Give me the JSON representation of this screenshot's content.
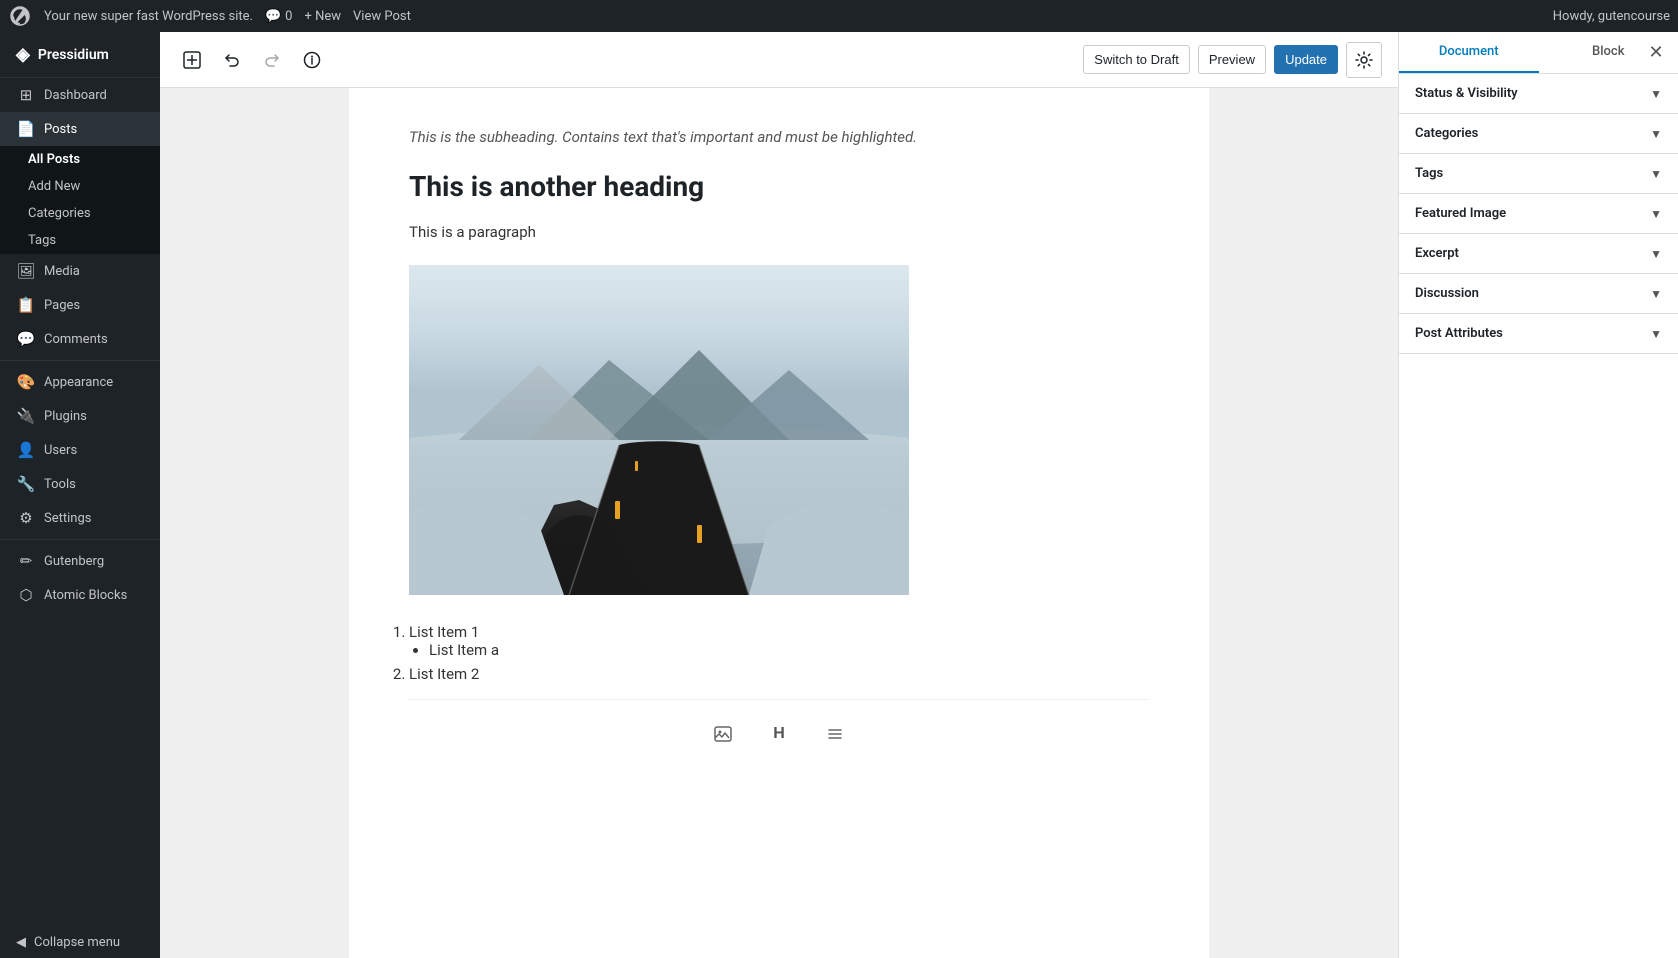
{
  "adminBar": {
    "wpIcon": "⊞",
    "siteName": "Your new super fast WordPress site.",
    "commentIcon": "💬",
    "commentCount": "0",
    "newLabel": "+ New",
    "viewPost": "View Post",
    "howdy": "Howdy, gutencourse"
  },
  "sidebar": {
    "brand": "Pressidium",
    "items": [
      {
        "id": "dashboard",
        "label": "Dashboard",
        "icon": "⊞"
      },
      {
        "id": "posts",
        "label": "Posts",
        "icon": "📄",
        "active": true,
        "children": [
          {
            "id": "all-posts",
            "label": "All Posts",
            "activeChild": true
          },
          {
            "id": "add-new",
            "label": "Add New"
          },
          {
            "id": "categories",
            "label": "Categories"
          },
          {
            "id": "tags",
            "label": "Tags"
          }
        ]
      },
      {
        "id": "media",
        "label": "Media",
        "icon": "🖼"
      },
      {
        "id": "pages",
        "label": "Pages",
        "icon": "📋"
      },
      {
        "id": "comments",
        "label": "Comments",
        "icon": "💬"
      },
      {
        "id": "appearance",
        "label": "Appearance",
        "icon": "🎨"
      },
      {
        "id": "plugins",
        "label": "Plugins",
        "icon": "🔌"
      },
      {
        "id": "users",
        "label": "Users",
        "icon": "👤"
      },
      {
        "id": "tools",
        "label": "Tools",
        "icon": "🔧"
      },
      {
        "id": "settings",
        "label": "Settings",
        "icon": "⚙"
      },
      {
        "id": "gutenberg",
        "label": "Gutenberg",
        "icon": "✏"
      },
      {
        "id": "atomic-blocks",
        "label": "Atomic Blocks",
        "icon": "⬡"
      }
    ],
    "collapse": "Collapse menu"
  },
  "toolbar": {
    "addBlock": "+",
    "undo": "↩",
    "redo": "↪",
    "info": "ℹ",
    "switchDraft": "Switch to Draft",
    "preview": "Preview",
    "update": "Update",
    "settings": "⚙"
  },
  "editor": {
    "subheading": "This is the subheading. Contains text that's important and must be highlighted.",
    "heading2": "This is another heading",
    "paragraph": "This is a paragraph",
    "listItems": [
      {
        "type": "ordered",
        "text": "List Item 1",
        "subItems": [
          {
            "text": "List Item a"
          }
        ]
      },
      {
        "type": "ordered",
        "text": "List Item 2"
      }
    ]
  },
  "rightPanel": {
    "tabs": [
      "Document",
      "Block"
    ],
    "activeTab": "Document",
    "sections": [
      {
        "id": "status-visibility",
        "label": "Status & Visibility"
      },
      {
        "id": "categories",
        "label": "Categories"
      },
      {
        "id": "tags",
        "label": "Tags"
      },
      {
        "id": "featured-image",
        "label": "Featured Image"
      },
      {
        "id": "excerpt",
        "label": "Excerpt"
      },
      {
        "id": "discussion",
        "label": "Discussion"
      },
      {
        "id": "post-attributes",
        "label": "Post Attributes"
      }
    ]
  },
  "blockToolbar": {
    "imageIcon": "🖼",
    "headingIcon": "H",
    "listIcon": "☰"
  },
  "colors": {
    "primary": "#2271b1",
    "sidebar": "#1d2327",
    "activeTab": "#007cba",
    "text": "#1d2327"
  }
}
